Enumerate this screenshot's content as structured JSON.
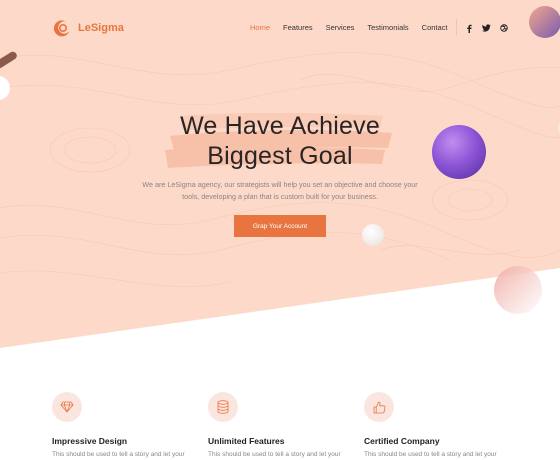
{
  "brand": {
    "name": "LeSigma",
    "accent": "#e8753f",
    "hero_bg": "#fdd9c9"
  },
  "nav": {
    "items": [
      {
        "label": "Home",
        "active": true
      },
      {
        "label": "Features",
        "active": false
      },
      {
        "label": "Services",
        "active": false
      },
      {
        "label": "Testimonials",
        "active": false
      },
      {
        "label": "Contact",
        "active": false
      }
    ]
  },
  "social": [
    {
      "icon": "facebook-icon",
      "glyph": "f"
    },
    {
      "icon": "twitter-icon",
      "glyph": "t"
    },
    {
      "icon": "dribbble-icon",
      "glyph": "d"
    }
  ],
  "hero": {
    "title_line1": "We Have Achieve",
    "title_line2": "Biggest Goal",
    "subtitle_line1": "We are LeSigma agency, our strategists will help you set an objective and choose your",
    "subtitle_line2": "tools, developing a plan that is custom built for your business.",
    "cta_label": "Grap Your Account"
  },
  "features": [
    {
      "icon": "diamond-icon",
      "title": "Impressive Design",
      "text": "This should be used to tell a story and let your"
    },
    {
      "icon": "database-icon",
      "title": "Unlimited Features",
      "text": "This should be used to tell a story and let your"
    },
    {
      "icon": "thumbs-up-icon",
      "title": "Certified Company",
      "text": "This should be used to tell a story and let your"
    }
  ]
}
